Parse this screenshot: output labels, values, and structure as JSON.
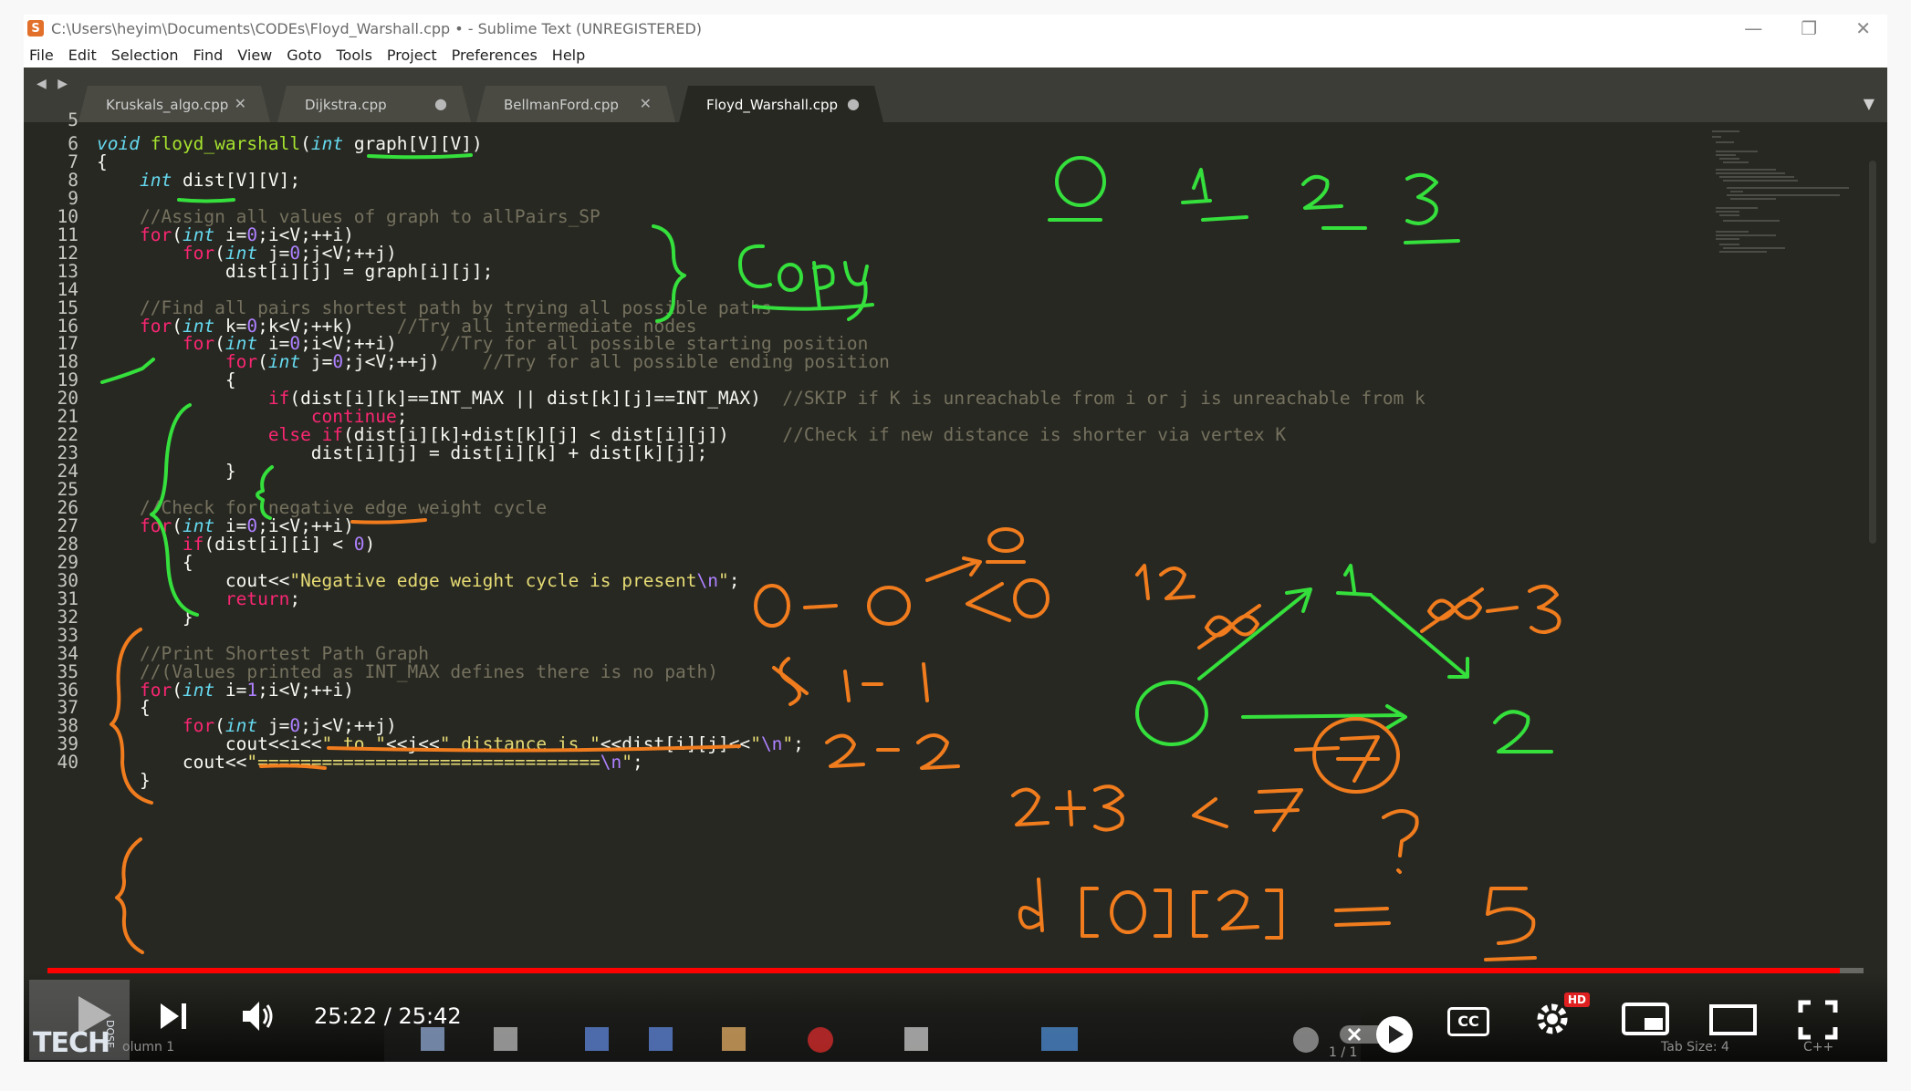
{
  "window": {
    "title": "C:\\Users\\heyim\\Documents\\CODEs\\Floyd_Warshall.cpp • - Sublime Text (UNREGISTERED)",
    "controls": [
      "—",
      "❐",
      "✕"
    ]
  },
  "menu": [
    "File",
    "Edit",
    "Selection",
    "Find",
    "View",
    "Goto",
    "Tools",
    "Project",
    "Preferences",
    "Help"
  ],
  "tabs": [
    {
      "label": "Kruskals_algo.cpp",
      "mark": "✕",
      "active": false
    },
    {
      "label": "Dijkstra.cpp",
      "mark": "●",
      "active": false
    },
    {
      "label": "BellmanFord.cpp",
      "mark": "✕",
      "active": false
    },
    {
      "label": "Floyd_Warshall.cpp",
      "mark": "●",
      "active": true
    }
  ],
  "tab_nav": "◀ ▶",
  "tab_menu": "▼",
  "editor": {
    "first_partial_line": "5",
    "lines": [
      {
        "n": "6",
        "html": "<span class='t'>void</span> <span class='f'>floyd_warshall</span>(<span class='t'>int</span> graph[V][V])"
      },
      {
        "n": "7",
        "html": "{"
      },
      {
        "n": "8",
        "html": "    <span class='t'>int</span> dist[V][V];"
      },
      {
        "n": "9",
        "html": ""
      },
      {
        "n": "10",
        "html": "    <span class='c'>//Assign all values of graph to allPairs_SP</span>"
      },
      {
        "n": "11",
        "html": "    <span class='k'>for</span>(<span class='t'>int</span> i=<span class='n'>0</span>;i&lt;V;++i)"
      },
      {
        "n": "12",
        "html": "        <span class='k'>for</span>(<span class='t'>int</span> j=<span class='n'>0</span>;j&lt;V;++j)"
      },
      {
        "n": "13",
        "html": "            dist[i][j] = graph[i][j];"
      },
      {
        "n": "14",
        "html": ""
      },
      {
        "n": "15",
        "html": "    <span class='c'>//Find all pairs shortest path by trying all possible paths</span>"
      },
      {
        "n": "16",
        "html": "    <span class='k'>for</span>(<span class='t'>int</span> k=<span class='n'>0</span>;k&lt;V;++k)    <span class='c'>//Try all intermediate nodes</span>"
      },
      {
        "n": "17",
        "html": "        <span class='k'>for</span>(<span class='t'>int</span> i=<span class='n'>0</span>;i&lt;V;++i)    <span class='c'>//Try for all possible starting position</span>"
      },
      {
        "n": "18",
        "html": "            <span class='k'>for</span>(<span class='t'>int</span> j=<span class='n'>0</span>;j&lt;V;++j)    <span class='c'>//Try for all possible ending position</span>"
      },
      {
        "n": "19",
        "html": "            {"
      },
      {
        "n": "20",
        "html": "                <span class='k'>if</span>(dist[i][k]==INT_MAX || dist[k][j]==INT_MAX)  <span class='c'>//SKIP if K is unreachable from i or j is unreachable from k</span>"
      },
      {
        "n": "21",
        "html": "                    <span class='k'>continue</span>;"
      },
      {
        "n": "22",
        "html": "                <span class='k'>else</span> <span class='k'>if</span>(dist[i][k]+dist[k][j] &lt; dist[i][j])     <span class='c'>//Check if new distance is shorter via vertex K</span>"
      },
      {
        "n": "23",
        "html": "                    dist[i][j] = dist[i][k] + dist[k][j];"
      },
      {
        "n": "24",
        "html": "            }"
      },
      {
        "n": "25",
        "html": ""
      },
      {
        "n": "26",
        "html": "    <span class='c'>//Check for negative edge weight cycle</span>"
      },
      {
        "n": "27",
        "html": "    <span class='k'>for</span>(<span class='t'>int</span> i=<span class='n'>0</span>;i&lt;V;++i)"
      },
      {
        "n": "28",
        "html": "        <span class='k'>if</span>(dist[i][i] &lt; <span class='n'>0</span>)"
      },
      {
        "n": "29",
        "html": "        {"
      },
      {
        "n": "30",
        "html": "            cout&lt;&lt;<span class='s'>\"Negative edge weight cycle is present<span class='n'>\\n</span>\"</span>;"
      },
      {
        "n": "31",
        "html": "            <span class='k'>return</span>;"
      },
      {
        "n": "32",
        "html": "        }"
      },
      {
        "n": "33",
        "html": ""
      },
      {
        "n": "34",
        "html": "    <span class='c'>//Print Shortest Path Graph</span>"
      },
      {
        "n": "35",
        "html": "    <span class='c'>//(Values printed as INT_MAX defines there is no path)</span>"
      },
      {
        "n": "36",
        "html": "    <span class='k'>for</span>(<span class='t'>int</span> i=<span class='n'>1</span>;i&lt;V;++i)"
      },
      {
        "n": "37",
        "html": "    {"
      },
      {
        "n": "38",
        "html": "        <span class='k'>for</span>(<span class='t'>int</span> j=<span class='n'>0</span>;j&lt;V;++j)"
      },
      {
        "n": "39",
        "html": "            cout&lt;&lt;i&lt;&lt;<span class='s'>\" to \"</span>&lt;&lt;j&lt;&lt;<span class='s'>\" distance is \"</span>&lt;&lt;dist[i][j]&lt;&lt;<span class='s'>\"<span class='n'>\\n</span>\"</span>;"
      },
      {
        "n": "40",
        "html": "        cout&lt;&lt;<span class='s'>\"================================<span class='n'>\\n</span>\"</span>;"
      },
      {
        "n": "",
        "html": "    }"
      }
    ]
  },
  "annotations": {
    "vertex_labels": [
      "0",
      "1",
      "2",
      "3"
    ],
    "copy_note": "Copy",
    "orange_notes": [
      "0",
      "0",
      "0",
      "0",
      "1 − 1",
      "2 − 2",
      "12",
      "∞",
      "2+3",
      "< 7",
      "?",
      "d[0][2] = 5"
    ],
    "graph_nodes": [
      "0",
      "1",
      "2",
      "3"
    ],
    "graph_weights": [
      "∞",
      "∞",
      "7"
    ],
    "colors": {
      "green": "#35e03c",
      "orange": "#f07c1e",
      "underline_orange": "#f07c1e"
    }
  },
  "player": {
    "time": "25:22 / 25:42",
    "progress": 0.987,
    "hd_badge": "HD",
    "cc_label": "CC",
    "colors": {
      "progress": "#ff0000"
    }
  },
  "statusbar": {
    "column": "olumn 1",
    "pager": "1 / 1",
    "tab_size": "Tab Size: 4",
    "language": "C++"
  },
  "logo": {
    "text": "TECH",
    "sub": "DOSE"
  }
}
